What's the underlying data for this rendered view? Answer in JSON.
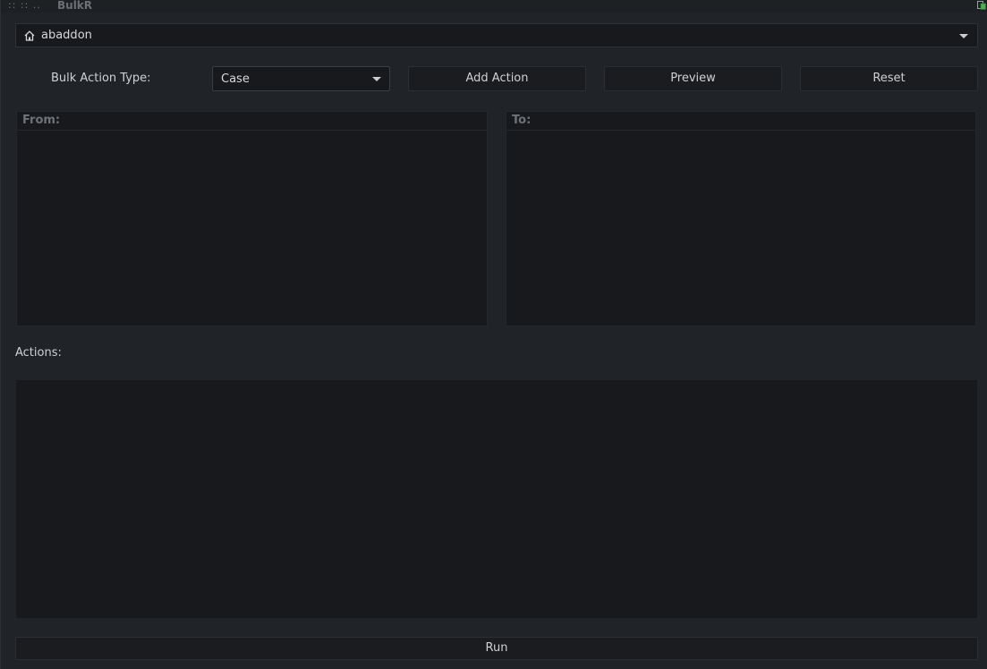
{
  "window": {
    "title": "BulkR",
    "grips": "::  ::  .."
  },
  "path": {
    "value": "abaddon",
    "icon": "home-icon"
  },
  "bulk_action": {
    "label": "Bulk Action Type:",
    "selected": "Case"
  },
  "toolbar": {
    "add_label": "Add Action",
    "preview_label": "Preview",
    "reset_label": "Reset"
  },
  "panes": {
    "from_header": "From:",
    "to_header": "To:"
  },
  "actions": {
    "label": "Actions:"
  },
  "run": {
    "label": "Run"
  },
  "colors": {
    "background": "#202327",
    "field": "#17191c",
    "button": "#1a1c1f",
    "text": "#cfd1d3",
    "muted_header": "#6f7378"
  }
}
